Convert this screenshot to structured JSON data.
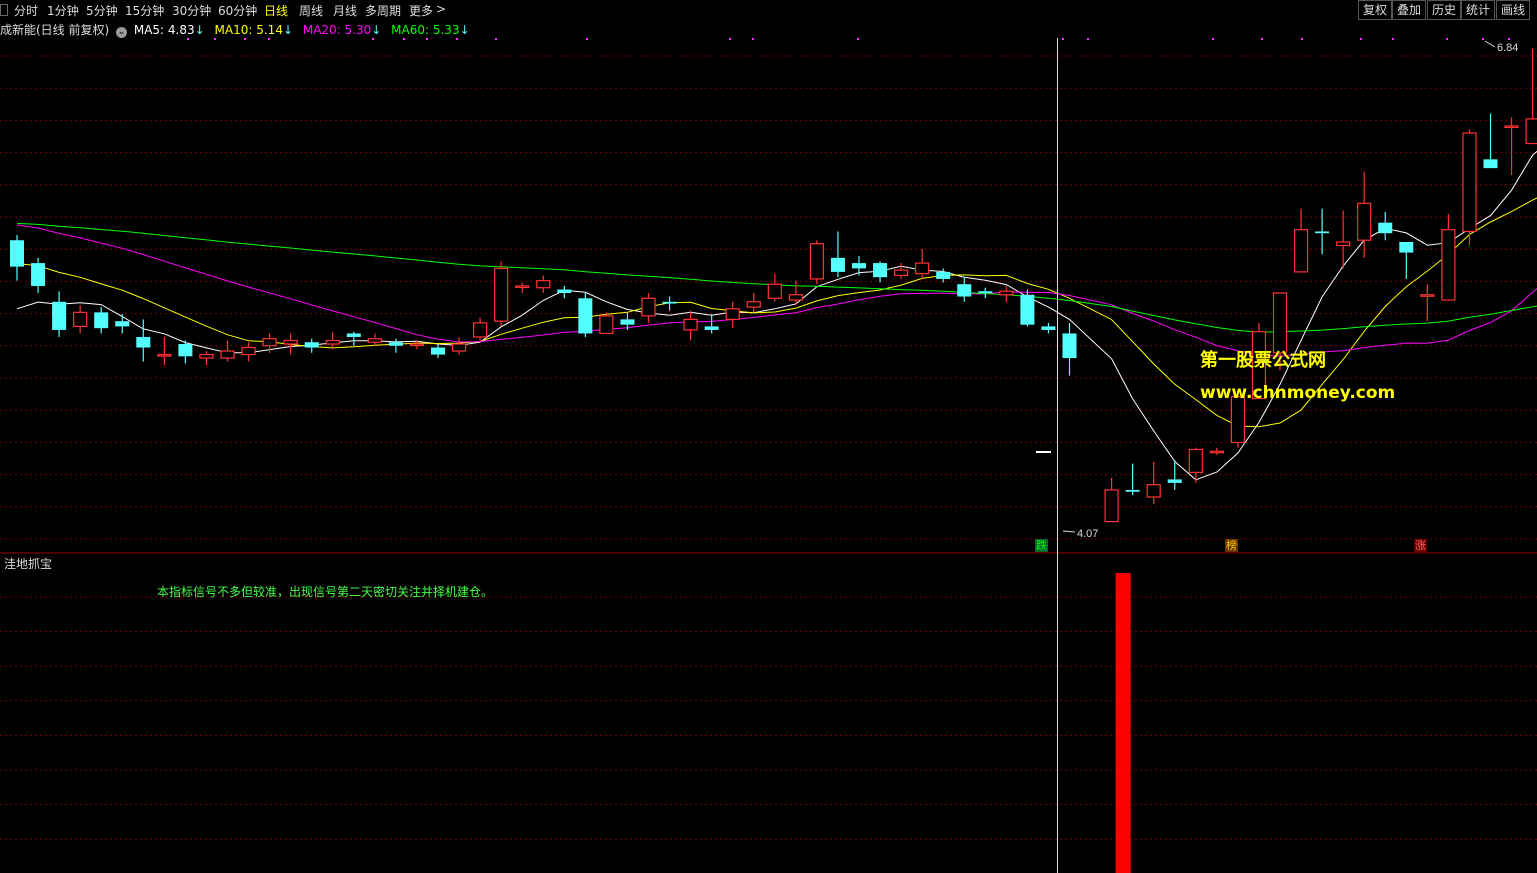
{
  "toolbar": {
    "periods": [
      "分时",
      "1分钟",
      "5分钟",
      "15分钟",
      "30分钟",
      "60分钟",
      "日线",
      "周线",
      "月线",
      "多周期",
      "更多"
    ],
    "active_period": "日线",
    "more_arrow": ">",
    "tools": [
      "复权",
      "叠加",
      "历史",
      "统计",
      "画线"
    ]
  },
  "legend": {
    "stock_title": "成新能(日线 前复权)",
    "ma5": {
      "label": "MA5:",
      "value": "4.83",
      "arrow": "↓",
      "color": "#ffffff"
    },
    "ma10": {
      "label": "MA10:",
      "value": "5.14",
      "arrow": "↓",
      "color": "#ffff00"
    },
    "ma20": {
      "label": "MA20:",
      "value": "5.30",
      "arrow": "↓",
      "color": "#ff00ff"
    },
    "ma60": {
      "label": "MA60:",
      "value": "5.33",
      "arrow": "↓",
      "color": "#00ff00"
    }
  },
  "price_labels": {
    "high": "6.84",
    "low": "4.07"
  },
  "badges": {
    "fall": "跌",
    "rank": "榜",
    "rise": "涨"
  },
  "watermark": {
    "line1": "第一股票公式网",
    "line2": "www.chnmoney.com"
  },
  "indicator": {
    "title": "洼地抓宝",
    "note": "本指标信号不多但较准，出现信号第二天密切关注并择机建仓。"
  },
  "colors": {
    "up": "#ff3333",
    "down": "#54ffff",
    "grid": "#7a0000",
    "signal": "#ff0000"
  },
  "chart_data": {
    "type": "candlestick",
    "candles": [
      [
        5.75,
        5.6,
        5.78,
        5.52
      ],
      [
        5.62,
        5.49,
        5.65,
        5.45
      ],
      [
        5.4,
        5.24,
        5.46,
        5.2
      ],
      [
        5.26,
        5.34,
        5.38,
        5.22
      ],
      [
        5.34,
        5.25,
        5.37,
        5.22
      ],
      [
        5.29,
        5.26,
        5.33,
        5.22
      ],
      [
        5.2,
        5.14,
        5.3,
        5.06
      ],
      [
        5.1,
        5.1,
        5.2,
        5.04
      ],
      [
        5.16,
        5.09,
        5.18,
        5.05
      ],
      [
        5.08,
        5.1,
        5.12,
        5.04
      ],
      [
        5.08,
        5.12,
        5.18,
        5.06
      ],
      [
        5.1,
        5.14,
        5.17,
        5.06
      ],
      [
        5.15,
        5.19,
        5.22,
        5.11
      ],
      [
        5.16,
        5.18,
        5.22,
        5.1
      ],
      [
        5.17,
        5.14,
        5.19,
        5.11
      ],
      [
        5.16,
        5.18,
        5.23,
        5.13
      ],
      [
        5.22,
        5.2,
        5.23,
        5.15
      ],
      [
        5.17,
        5.19,
        5.22,
        5.15
      ],
      [
        5.17,
        5.15,
        5.19,
        5.11
      ],
      [
        5.16,
        5.16,
        5.18,
        5.13
      ],
      [
        5.14,
        5.1,
        5.16,
        5.08
      ],
      [
        5.12,
        5.16,
        5.2,
        5.1
      ],
      [
        5.2,
        5.28,
        5.31,
        5.18
      ],
      [
        5.29,
        5.59,
        5.63,
        5.26
      ],
      [
        5.49,
        5.49,
        5.51,
        5.45
      ],
      [
        5.48,
        5.52,
        5.55,
        5.45
      ],
      [
        5.47,
        5.45,
        5.49,
        5.42
      ],
      [
        5.42,
        5.22,
        5.45,
        5.2
      ],
      [
        5.22,
        5.32,
        5.34,
        5.22
      ],
      [
        5.3,
        5.27,
        5.34,
        5.24
      ],
      [
        5.32,
        5.42,
        5.45,
        5.28
      ],
      [
        5.4,
        5.39,
        5.43,
        5.35
      ],
      [
        5.24,
        5.3,
        5.35,
        5.18
      ],
      [
        5.26,
        5.24,
        5.33,
        5.22
      ],
      [
        5.3,
        5.36,
        5.4,
        5.25
      ],
      [
        5.37,
        5.4,
        5.45,
        5.34
      ],
      [
        5.42,
        5.5,
        5.56,
        5.4
      ],
      [
        5.41,
        5.44,
        5.52,
        5.38
      ],
      [
        5.53,
        5.73,
        5.75,
        5.5
      ],
      [
        5.65,
        5.57,
        5.8,
        5.54
      ],
      [
        5.62,
        5.59,
        5.66,
        5.55
      ],
      [
        5.62,
        5.54,
        5.63,
        5.51
      ],
      [
        5.55,
        5.58,
        5.62,
        5.53
      ],
      [
        5.56,
        5.62,
        5.7,
        5.53
      ],
      [
        5.57,
        5.53,
        5.59,
        5.51
      ],
      [
        5.5,
        5.43,
        5.54,
        5.4
      ],
      [
        5.46,
        5.45,
        5.48,
        5.42
      ],
      [
        5.44,
        5.46,
        5.49,
        5.4
      ],
      [
        5.44,
        5.27,
        5.47,
        5.26
      ],
      [
        5.26,
        5.24,
        5.28,
        5.22
      ],
      [
        5.22,
        5.08,
        5.28,
        4.98
      ],
      null,
      [
        4.15,
        4.33,
        4.4,
        4.15
      ],
      [
        4.33,
        4.32,
        4.48,
        4.3
      ],
      [
        4.29,
        4.36,
        4.49,
        4.25
      ],
      [
        4.39,
        4.37,
        4.5,
        4.33
      ],
      [
        4.43,
        4.56,
        4.57,
        4.37
      ],
      [
        4.55,
        4.55,
        4.57,
        4.53
      ],
      [
        4.6,
        4.86,
        4.9,
        4.57
      ],
      [
        4.85,
        5.23,
        5.28,
        4.85
      ],
      [
        5.11,
        5.45,
        5.45,
        5.01
      ],
      [
        5.57,
        5.81,
        5.93,
        5.57
      ],
      [
        5.8,
        5.79,
        5.93,
        5.67
      ],
      [
        5.72,
        5.74,
        5.92,
        5.59
      ],
      [
        5.75,
        5.96,
        6.14,
        5.65
      ],
      [
        5.85,
        5.79,
        5.91,
        5.75
      ],
      [
        5.74,
        5.68,
        5.74,
        5.53
      ],
      [
        5.44,
        5.44,
        5.5,
        5.29
      ],
      [
        5.41,
        5.81,
        5.9,
        5.56
      ],
      [
        5.8,
        6.36,
        6.38,
        5.72
      ],
      [
        6.21,
        6.16,
        6.47,
        6.16
      ],
      [
        6.4,
        6.4,
        6.45,
        6.12
      ],
      [
        6.3,
        6.44,
        6.84,
        6.3
      ],
      [
        6.41,
        6.32,
        6.45,
        6.26
      ],
      [
        6.43,
        6.33,
        6.4,
        6.19
      ]
    ],
    "ma_lines": [
      {
        "name": "MA5",
        "color": "#ffffff"
      },
      {
        "name": "MA10",
        "color": "#ffff00"
      },
      {
        "name": "MA20",
        "color": "#ff00ff"
      },
      {
        "name": "MA60",
        "color": "#00ff00"
      }
    ],
    "y_range": [
      4.0,
      6.9
    ],
    "signal_bar_index": 52,
    "signal_bar_value": 1
  }
}
